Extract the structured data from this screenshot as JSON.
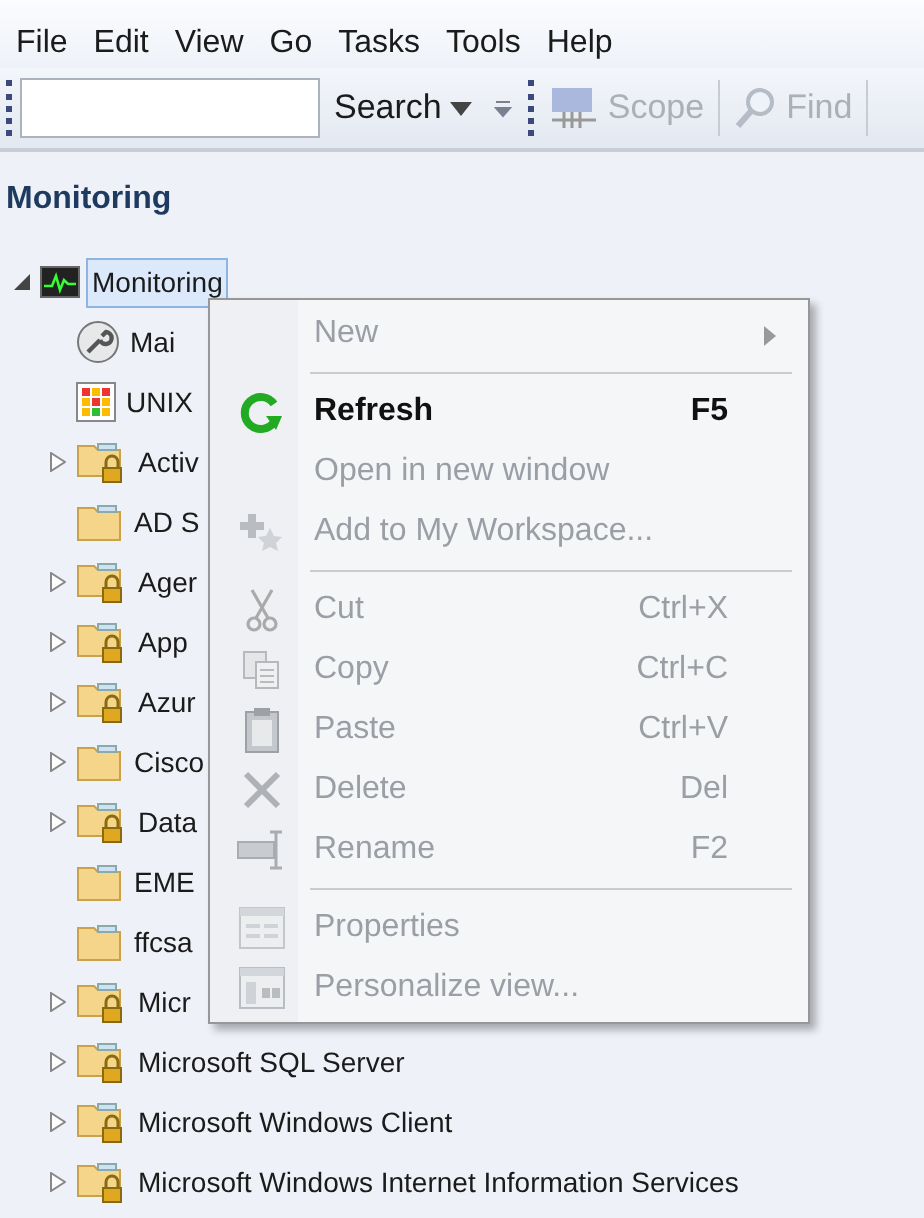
{
  "menu_bar": [
    "File",
    "Edit",
    "View",
    "Go",
    "Tasks",
    "Tools",
    "Help"
  ],
  "toolbar": {
    "search_button": "Search",
    "scope_button": {
      "label": "Scope",
      "disabled": true
    },
    "find_button": {
      "label": "Find",
      "disabled": true
    }
  },
  "pane_title": "Monitoring",
  "tree": [
    {
      "label": "Monitoring",
      "kind": "monitor",
      "has_children": true,
      "expanded": true,
      "selected": true,
      "children": [
        {
          "label": "Mai",
          "kind": "wrench",
          "has_children": false,
          "selected": false
        },
        {
          "label": "UNIX",
          "kind": "grid",
          "has_children": false,
          "selected": false
        },
        {
          "label": "Activ",
          "kind": "locked-folder",
          "has_children": true,
          "expanded": false,
          "selected": false
        },
        {
          "label": "AD S",
          "kind": "folder",
          "has_children": false,
          "selected": false
        },
        {
          "label": "Ager",
          "kind": "locked-folder",
          "has_children": true,
          "expanded": false,
          "selected": false
        },
        {
          "label": "App",
          "kind": "locked-folder",
          "has_children": true,
          "expanded": false,
          "selected": false
        },
        {
          "label": "Azur",
          "kind": "locked-folder",
          "has_children": true,
          "expanded": false,
          "selected": false
        },
        {
          "label": "Cisco",
          "kind": "folder",
          "has_children": true,
          "expanded": false,
          "selected": false
        },
        {
          "label": "Data",
          "kind": "locked-folder",
          "has_children": true,
          "expanded": false,
          "selected": false
        },
        {
          "label": "EME",
          "kind": "folder",
          "has_children": false,
          "selected": false
        },
        {
          "label": "ffcsa",
          "kind": "folder",
          "has_children": false,
          "selected": false
        },
        {
          "label": "Micr",
          "kind": "locked-folder",
          "has_children": true,
          "expanded": false,
          "selected": false
        },
        {
          "label": "Microsoft SQL Server",
          "kind": "locked-folder",
          "has_children": true,
          "expanded": false,
          "selected": false
        },
        {
          "label": "Microsoft Windows Client",
          "kind": "locked-folder",
          "has_children": true,
          "expanded": false,
          "selected": false
        },
        {
          "label": "Microsoft Windows Internet Information Services",
          "kind": "locked-folder",
          "has_children": true,
          "expanded": false,
          "selected": false
        }
      ]
    }
  ],
  "context_menu": [
    {
      "kind": "item",
      "label": "New",
      "submenu": true,
      "disabled": true
    },
    {
      "kind": "separator"
    },
    {
      "kind": "item",
      "label": "Refresh",
      "shortcut": "F5",
      "submenu": false,
      "disabled": false
    },
    {
      "kind": "item",
      "label": "Open in new window",
      "submenu": false,
      "disabled": true
    },
    {
      "kind": "item",
      "label": "Add to My Workspace...",
      "submenu": false,
      "disabled": true
    },
    {
      "kind": "separator"
    },
    {
      "kind": "item",
      "label": "Cut",
      "shortcut": "Ctrl+X",
      "submenu": false,
      "disabled": true
    },
    {
      "kind": "item",
      "label": "Copy",
      "shortcut": "Ctrl+C",
      "submenu": false,
      "disabled": true
    },
    {
      "kind": "item",
      "label": "Paste",
      "shortcut": "Ctrl+V",
      "submenu": false,
      "disabled": true
    },
    {
      "kind": "item",
      "label": "Delete",
      "shortcut": "Del",
      "submenu": false,
      "disabled": true
    },
    {
      "kind": "item",
      "label": "Rename",
      "shortcut": "F2",
      "submenu": false,
      "disabled": true
    },
    {
      "kind": "separator"
    },
    {
      "kind": "item",
      "label": "Properties",
      "submenu": false,
      "disabled": true
    },
    {
      "kind": "item",
      "label": "Personalize view...",
      "submenu": false,
      "disabled": true
    }
  ]
}
